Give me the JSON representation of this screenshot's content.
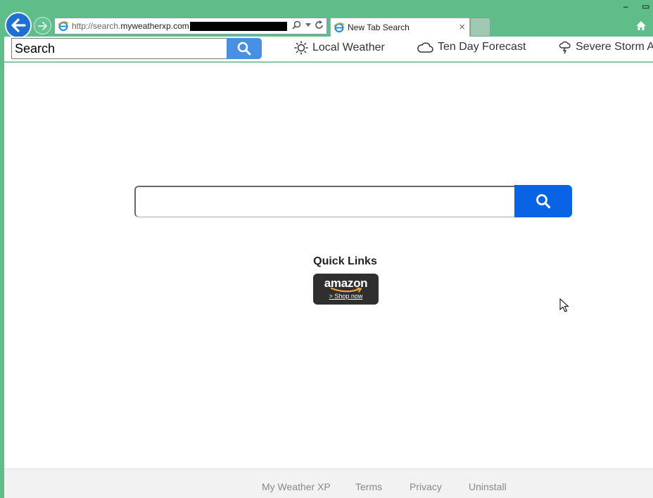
{
  "browser": {
    "url_prefix": "http://search.",
    "url_host": "myweatherxp.com",
    "tab_title": "New Tab Search",
    "tab_close": "×",
    "minimize": "–",
    "maximize": "▭"
  },
  "toolbar": {
    "search_value": "Search",
    "links": [
      {
        "label": "Local Weather",
        "icon": "sun-icon"
      },
      {
        "label": "Ten Day Forecast",
        "icon": "cloud-icon"
      },
      {
        "label": "Severe Storm A",
        "icon": "storm-icon"
      }
    ]
  },
  "main": {
    "search_value": "",
    "quick_links_title": "Quick Links",
    "amazon": {
      "brand": "amazon",
      "cta": "> Shop now",
      "color": "#2f2f2f"
    }
  },
  "footer": {
    "links": [
      "My Weather XP",
      "Terms",
      "Privacy",
      "Uninstall"
    ]
  },
  "colors": {
    "chrome_bg": "#5fbd8a",
    "search_blue": "#0a63e5",
    "toolbar_search_blue": "#4a90e2"
  }
}
